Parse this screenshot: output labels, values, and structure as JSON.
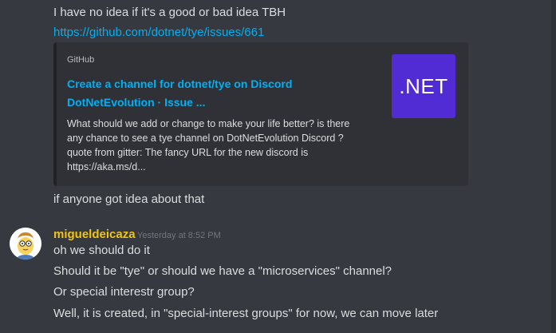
{
  "messages": {
    "line1": "I have no idea if it's a good or bad idea TBH",
    "link": "https://github.com/dotnet/tye/issues/661",
    "line_after_embed": "if anyone got idea about that"
  },
  "embed": {
    "provider": "GitHub",
    "title_line1": "Create a channel for dotnet/tye on Discord",
    "title_line2": "DotNetEvolution · Issue ...",
    "desc_line1": "What should we add or change to make your life better? is there",
    "desc_line2": "any chance to see a tye channel on DotNetEvolution Discord ?",
    "desc_line3": "quote from gitter: The fancy URL for the new discord is",
    "desc_line4": "https://aka.ms/d...",
    "thumbnail_text": ".NET",
    "thumbnail_color": "#512bd4"
  },
  "author": {
    "name": "migueldeicaza",
    "timestamp": "Yesterday at 8:52 PM",
    "name_color": "#f1c40f"
  },
  "author_messages": [
    "oh we should do it",
    "Should it be \"tye\" or should we have a \"microservices\" channel?",
    "Or special interestr group?",
    "Well, it is created, in \"special-interest groups\" for now, we can move later"
  ]
}
